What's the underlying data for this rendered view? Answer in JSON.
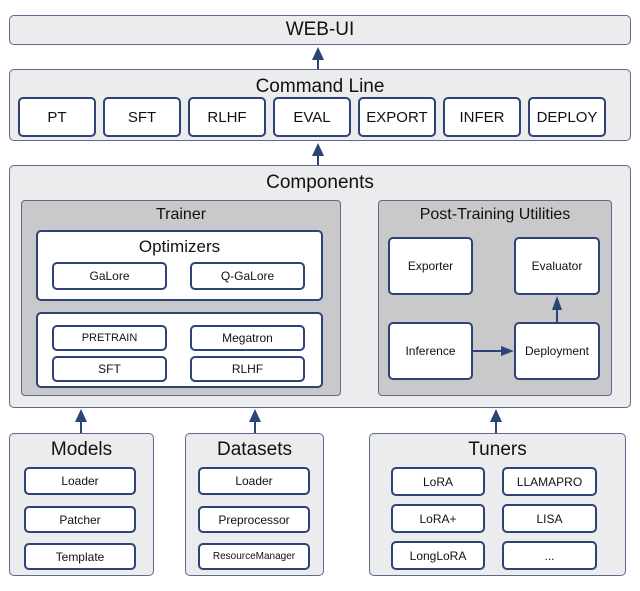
{
  "webui": {
    "title": "WEB-UI"
  },
  "command_line": {
    "title": "Command Line",
    "commands": [
      "PT",
      "SFT",
      "RLHF",
      "EVAL",
      "EXPORT",
      "INFER",
      "DEPLOY"
    ]
  },
  "components": {
    "title": "Components",
    "trainer": {
      "title": "Trainer",
      "optimizers": {
        "title": "Optimizers",
        "items": [
          "GaLore",
          "Q-GaLore"
        ]
      },
      "stages": [
        "PRETRAIN",
        "Megatron",
        "SFT",
        "RLHF"
      ]
    },
    "post_training": {
      "title": "Post-Training Utilities",
      "exporter": "Exporter",
      "evaluator": "Evaluator",
      "inference": "Inference",
      "deployment": "Deployment"
    }
  },
  "models": {
    "title": "Models",
    "items": [
      "Loader",
      "Patcher",
      "Template"
    ]
  },
  "datasets": {
    "title": "Datasets",
    "items": [
      "Loader",
      "Preprocessor",
      "ResourceManager"
    ]
  },
  "tuners": {
    "title": "Tuners",
    "items": [
      "LoRA",
      "LLAMAPRO",
      "LoRA+",
      "LISA",
      "LongLoRA",
      "..."
    ]
  },
  "colors": {
    "border": "#2d4375",
    "panel": "#ececee",
    "inner_panel": "#c9c9cb"
  }
}
